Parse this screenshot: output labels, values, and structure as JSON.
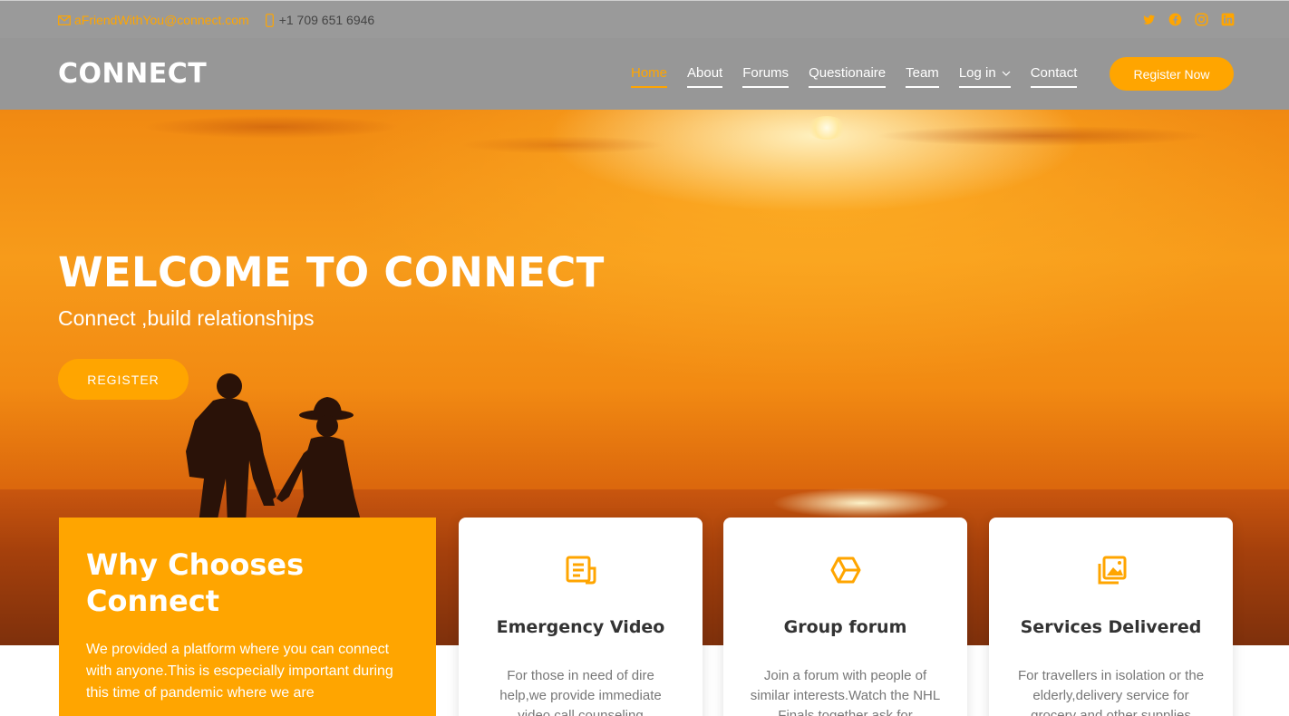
{
  "topbar": {
    "email": "aFriendWithYou@connect.com",
    "phone": "+1 709 651 6946",
    "social_icons": [
      "twitter-icon",
      "facebook-icon",
      "instagram-icon",
      "linkedin-icon"
    ]
  },
  "header": {
    "logo": "CONNECT",
    "nav": [
      {
        "label": "Home",
        "active": true
      },
      {
        "label": "About"
      },
      {
        "label": "Forums"
      },
      {
        "label": "Questionaire"
      },
      {
        "label": "Team"
      },
      {
        "label": "Log in",
        "dropdown": true
      },
      {
        "label": "Contact"
      }
    ],
    "register_button": "Register Now"
  },
  "hero": {
    "title": "WELCOME TO CONNECT",
    "subtitle": "Connect ,build relationships",
    "button": "REGISTER"
  },
  "why": {
    "title": "Why Chooses Connect",
    "text": "We provided a platform where you can connect with anyone.This is escpecially important during this time of pandemic where we are"
  },
  "cards": [
    {
      "icon": "document-icon",
      "title": "Emergency Video",
      "text": "For those in need of dire help,we provide immediate video call counseling"
    },
    {
      "icon": "cube-icon",
      "title": "Group forum",
      "text": "Join a forum with people of similar interests.Watch the NHL Finals together ask for"
    },
    {
      "icon": "gallery-icon",
      "title": "Services Delivered",
      "text": "For travellers in isolation or the elderly,delivery service for grocery and other supplies"
    }
  ],
  "colors": {
    "accent": "#ffa500",
    "header_bg": "#979797",
    "topbar_bg": "#9a9a9a"
  }
}
